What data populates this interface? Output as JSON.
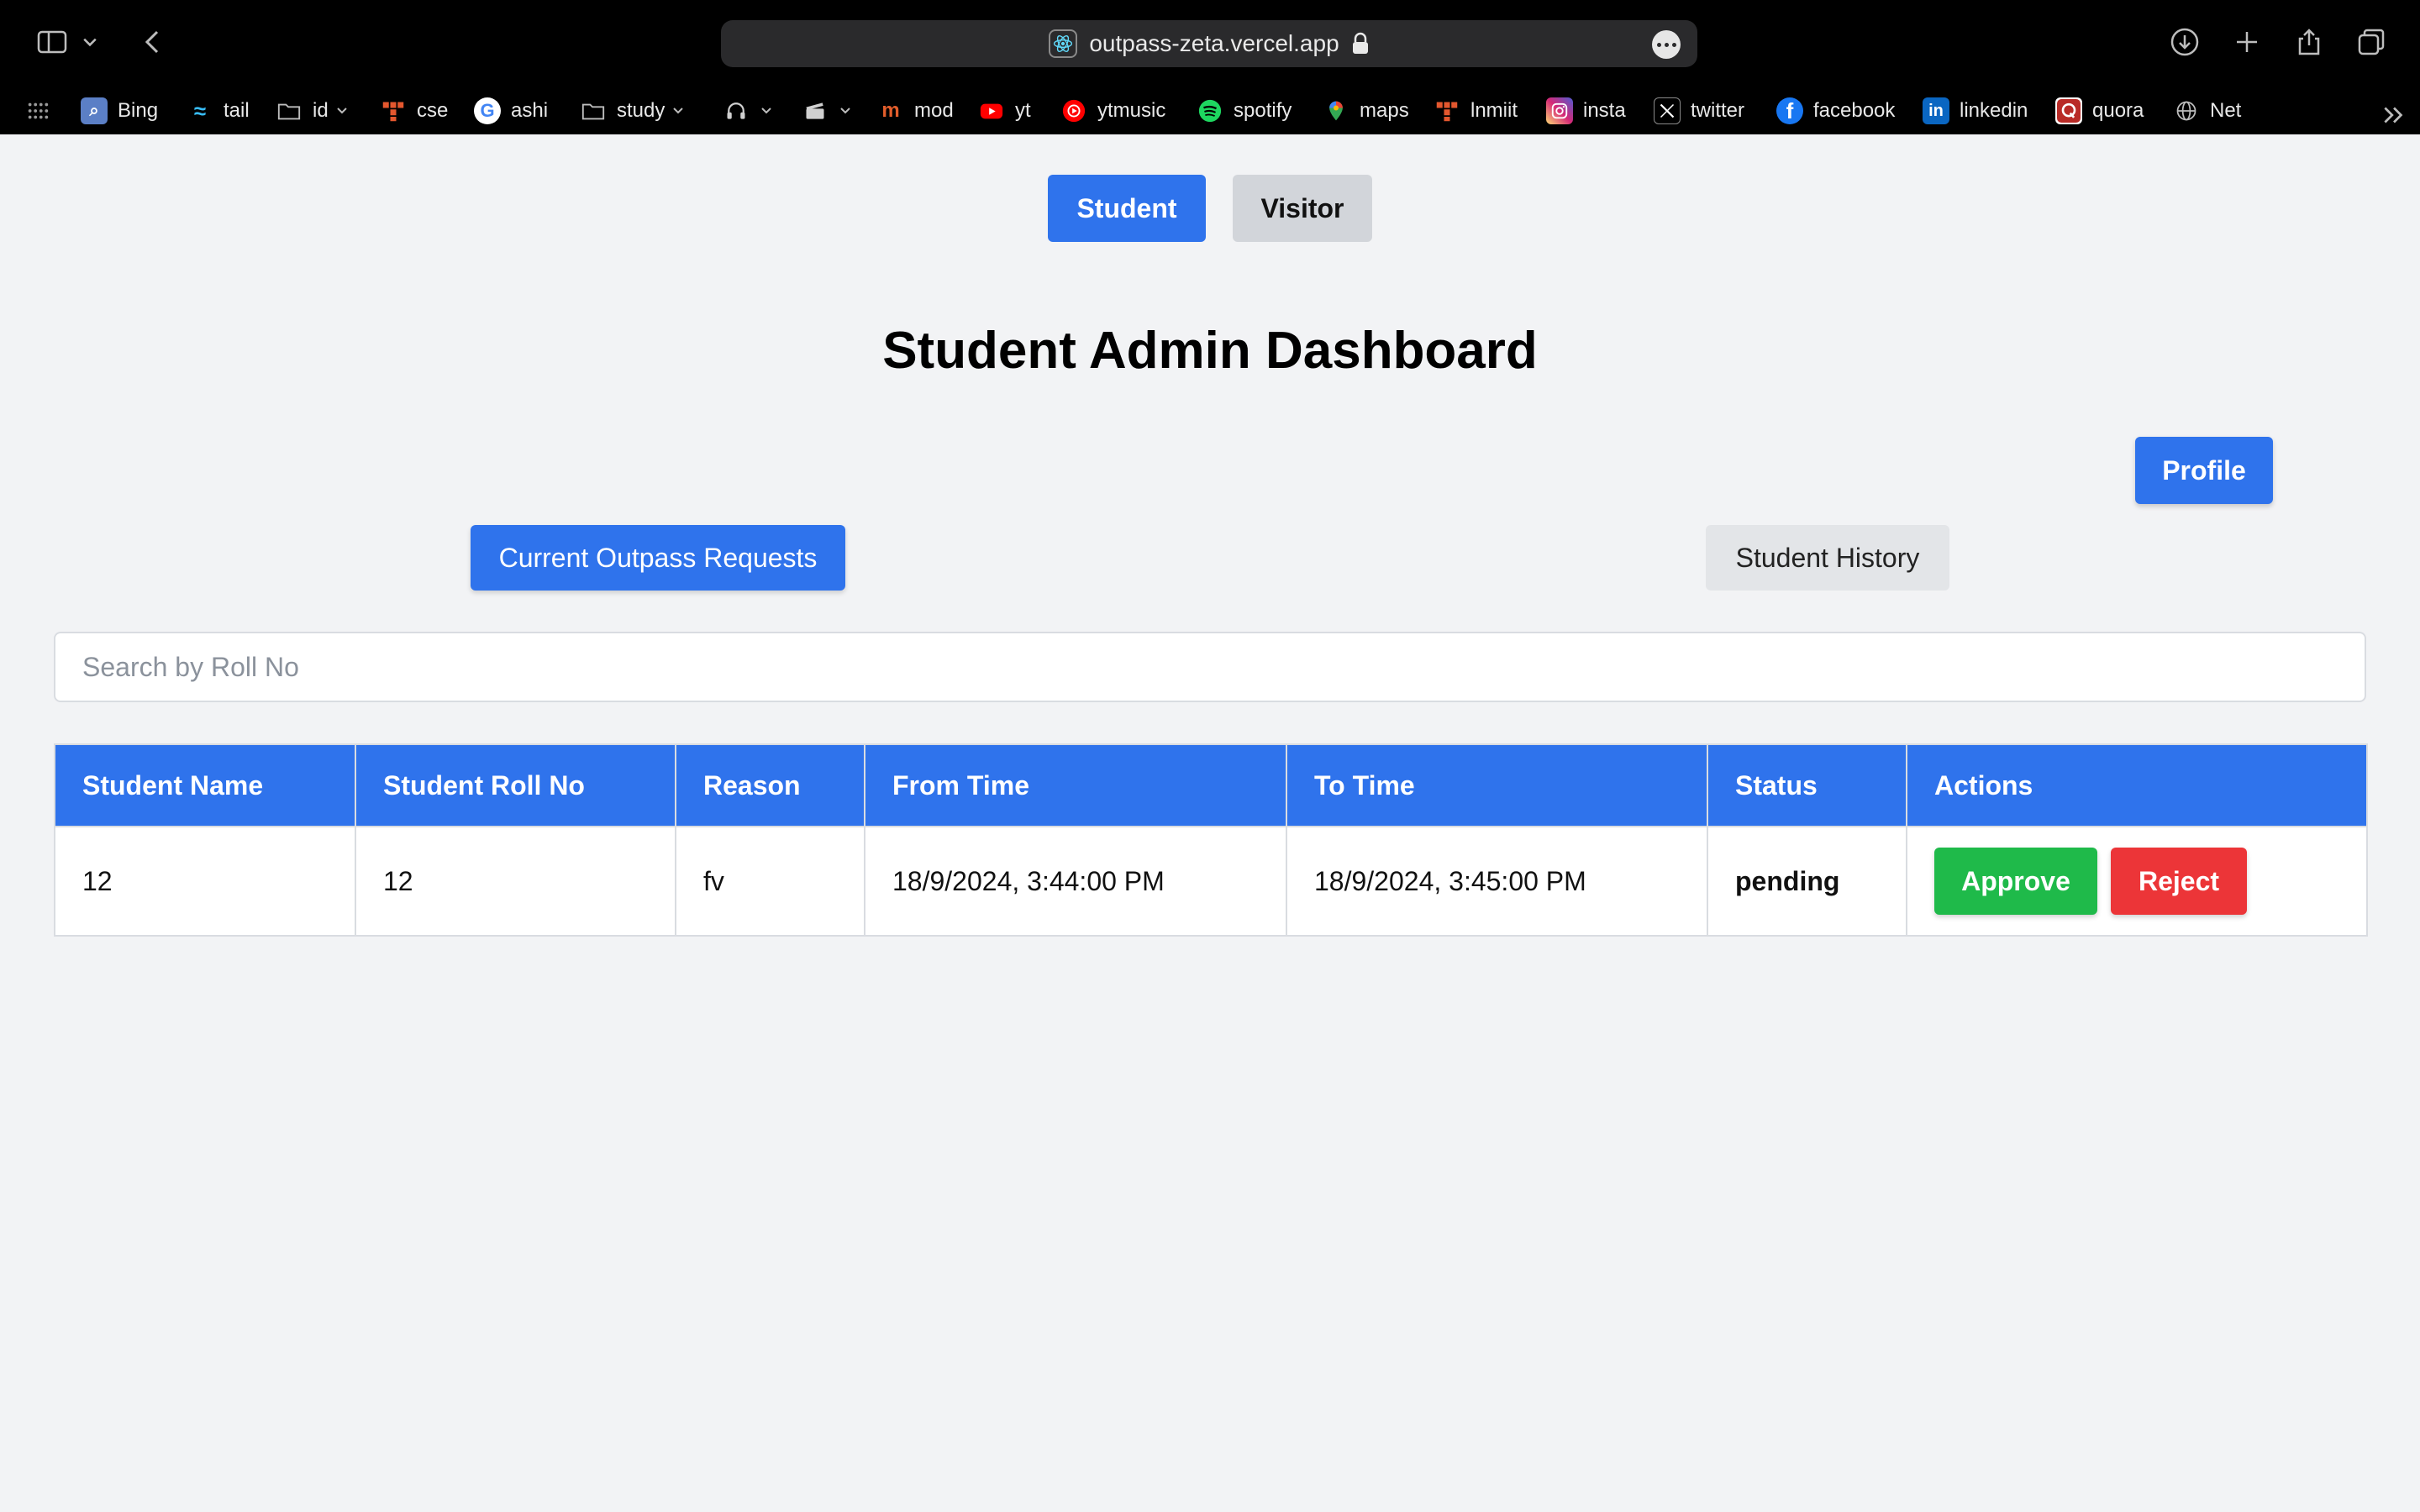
{
  "browser": {
    "url": "outpass-zeta.vercel.app",
    "bookmarks": [
      {
        "label": "Bing",
        "icon": "bing-icon",
        "color": "#4a7bd0"
      },
      {
        "label": "tail",
        "icon": "tailwind-icon",
        "color": "#38bdf8"
      },
      {
        "label": "id",
        "icon": "folder-icon",
        "color": "#000000"
      },
      {
        "label": "cse",
        "icon": "cse-icon",
        "color": "#e4572e"
      },
      {
        "label": "ashi",
        "icon": "google-icon",
        "color": "#ffffff"
      },
      {
        "label": "study",
        "icon": "folder-icon",
        "color": "#000000"
      },
      {
        "label": "",
        "icon": "headphones-icon",
        "color": "#000000"
      },
      {
        "label": "",
        "icon": "clapperboard-icon",
        "color": "#000000"
      },
      {
        "label": "mod",
        "icon": "mod-icon",
        "color": "#e25d2b"
      },
      {
        "label": "yt",
        "icon": "youtube-icon",
        "color": "#ff0000"
      },
      {
        "label": "ytmusic",
        "icon": "ytmusic-icon",
        "color": "#ff0000"
      },
      {
        "label": "spotify",
        "icon": "spotify-icon",
        "color": "#1ed760"
      },
      {
        "label": "maps",
        "icon": "maps-icon",
        "color": "#34a853"
      },
      {
        "label": "lnmiit",
        "icon": "lnmiit-icon",
        "color": "#e4572e"
      },
      {
        "label": "insta",
        "icon": "instagram-icon",
        "color": "#d62976"
      },
      {
        "label": "twitter",
        "icon": "x-icon",
        "color": "#000000"
      },
      {
        "label": "facebook",
        "icon": "facebook-icon",
        "color": "#1877f2"
      },
      {
        "label": "linkedin",
        "icon": "linkedin-icon",
        "color": "#0a66c2"
      },
      {
        "label": "quora",
        "icon": "quora-icon",
        "color": "#b92b27"
      },
      {
        "label": "Net",
        "icon": "globe-icon",
        "color": "#000000"
      }
    ]
  },
  "mode_tabs": {
    "student": "Student",
    "visitor": "Visitor",
    "active": "Student"
  },
  "page": {
    "title": "Student Admin Dashboard",
    "profile_button": "Profile",
    "tabs": {
      "current": "Current Outpass Requests",
      "history": "Student History"
    },
    "search": {
      "placeholder": "Search by Roll No",
      "value": ""
    }
  },
  "table": {
    "headers": [
      "Student Name",
      "Student Roll No",
      "Reason",
      "From Time",
      "To Time",
      "Status",
      "Actions"
    ],
    "rows": [
      {
        "name": "12",
        "roll": "12",
        "reason": "fv",
        "from": "18/9/2024, 3:44:00 PM",
        "to": "18/9/2024, 3:45:00 PM",
        "status": "pending",
        "approve": "Approve",
        "reject": "Reject"
      }
    ]
  },
  "colors": {
    "primary": "#2f73ec",
    "approve": "#1fba4a",
    "reject": "#ec3538",
    "pending": "#e0a20c"
  }
}
